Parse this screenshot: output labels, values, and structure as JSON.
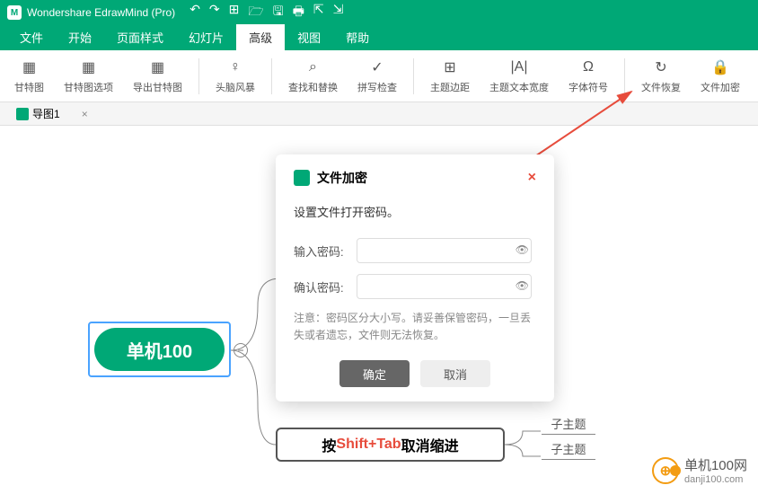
{
  "titlebar": {
    "logo": "M",
    "title": "Wondershare EdrawMind (Pro)"
  },
  "menus": [
    "文件",
    "开始",
    "页面样式",
    "幻灯片",
    "高级",
    "视图",
    "帮助"
  ],
  "menu_active": 4,
  "tools": [
    {
      "icon": "▦",
      "label": "甘特图"
    },
    {
      "icon": "▦",
      "label": "甘特图选项"
    },
    {
      "icon": "▦",
      "label": "导出甘特图"
    },
    {
      "sep": true
    },
    {
      "icon": "♀",
      "label": "头脑风暴"
    },
    {
      "sep": true
    },
    {
      "icon": "⌕",
      "label": "查找和替换"
    },
    {
      "icon": "✓",
      "label": "拼写检查"
    },
    {
      "sep": true
    },
    {
      "icon": "⊞",
      "label": "主题边距"
    },
    {
      "icon": "|A|",
      "label": "主题文本宽度"
    },
    {
      "icon": "Ω",
      "label": "字体符号"
    },
    {
      "sep": true
    },
    {
      "icon": "↻",
      "label": "文件恢复"
    },
    {
      "icon": "🔒",
      "label": "文件加密"
    }
  ],
  "tab": {
    "name": "导图1"
  },
  "canvas": {
    "main_topic": "单机100",
    "sub_topic_pre": "按 ",
    "sub_topic_key": "Shift+Tab",
    "sub_topic_post": " 取消缩进",
    "child1": "子主题",
    "child2": "子主题"
  },
  "dialog": {
    "title": "文件加密",
    "subtitle": "设置文件打开密码。",
    "label_pwd": "输入密码:",
    "label_confirm": "确认密码:",
    "placeholder": "",
    "note": "注意：密码区分大小写。请妥善保管密码，一旦丢失或者遗忘，文件则无法恢复。",
    "ok": "确定",
    "cancel": "取消"
  },
  "watermark": {
    "text": "单机100网",
    "url": "danji100.com"
  }
}
